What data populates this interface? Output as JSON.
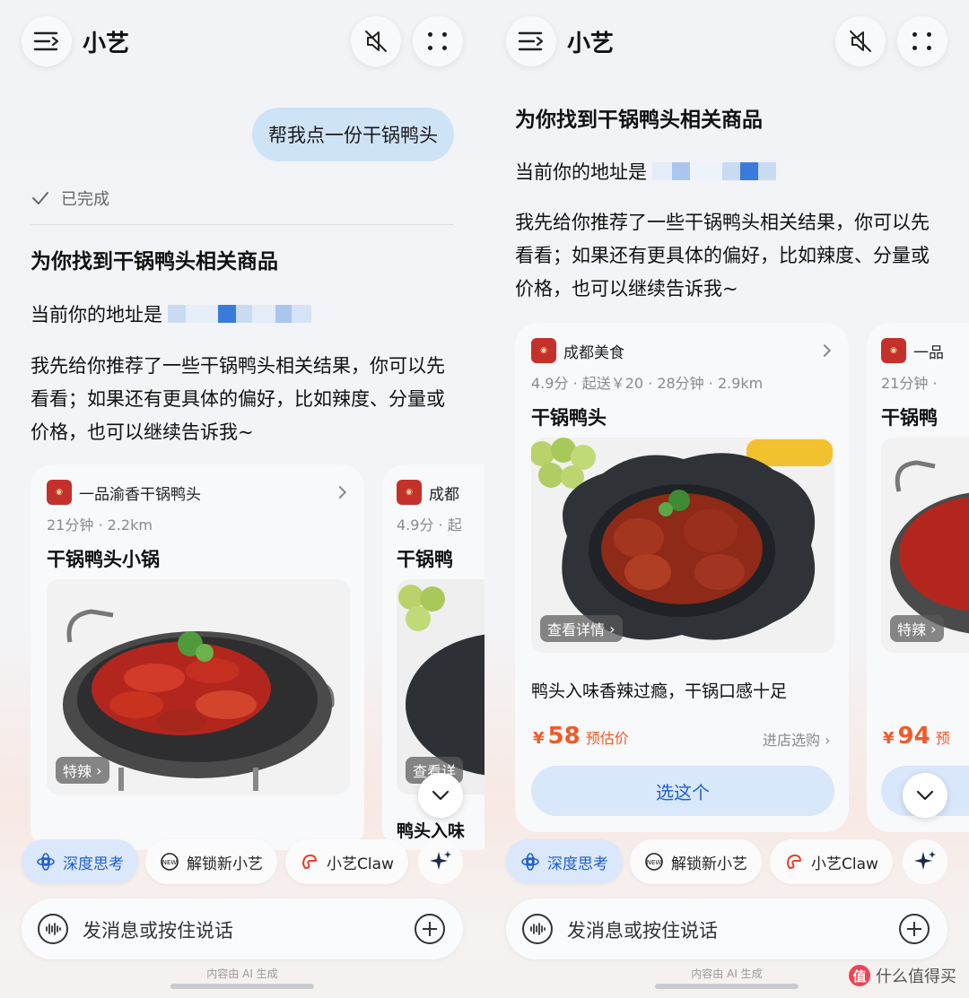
{
  "app": {
    "title": "小艺"
  },
  "left": {
    "user_message": "帮我点一份干锅鸭头",
    "status": "已完成",
    "result_title": "为你找到干锅鸭头相关商品",
    "address_label": "当前你的地址是",
    "paragraph": "我先给你推荐了一些干锅鸭头相关结果，你可以先看看；如果还有更具体的偏好，比如辣度、分量或价格，也可以继续告诉我~",
    "cards": [
      {
        "shop": "一品渝香干锅鸭头",
        "meta": "21分钟 · 2.2km",
        "dish": "干锅鸭头小锅",
        "tag": "特辣"
      },
      {
        "shop": "成都",
        "meta": "4.9分 · 起",
        "dish": "干锅鸭",
        "tag": "查看详",
        "desc": "鸭头入味"
      }
    ]
  },
  "right": {
    "result_title": "为你找到干锅鸭头相关商品",
    "address_label": "当前你的地址是",
    "paragraph": "我先给你推荐了一些干锅鸭头相关结果，你可以先看看；如果还有更具体的偏好，比如辣度、分量或价格，也可以继续告诉我~",
    "cards": [
      {
        "shop": "成都美食",
        "meta": "4.9分 · 起送￥20 · 28分钟 · 2.9km",
        "dish": "干锅鸭头",
        "tag": "查看详情",
        "desc": "鸭头入味香辣过瘾，干锅口感十足",
        "price_currency": "¥",
        "price": "58",
        "price_label": "预估价",
        "enter_store": "进店选购",
        "choose": "选这个"
      },
      {
        "shop": "一品",
        "meta": "21分钟 ·",
        "dish": "干锅鸭",
        "tag": "特辣",
        "price_currency": "¥",
        "price": "94",
        "price_label": "预"
      }
    ]
  },
  "chips": {
    "deep_think": "深度思考",
    "unlock": "解锁新小艺",
    "claw": "小艺Claw"
  },
  "input": {
    "placeholder": "发消息或按住说话"
  },
  "footer_note": "内容由 AI 生成",
  "watermark": "什么值得买",
  "watermark_logo": "值",
  "colors": {
    "accent_blue": "#1f5fcf",
    "price_orange": "#f05a28",
    "bubble_blue": "#cfe3f7"
  },
  "icons": [
    "menu-icon",
    "mute-icon",
    "more-dots-icon",
    "check-icon",
    "chevron-right-icon",
    "chevron-down-icon",
    "deep-think-icon",
    "new-badge-icon",
    "claw-icon",
    "sparkle-icon",
    "voice-icon",
    "plus-icon"
  ]
}
